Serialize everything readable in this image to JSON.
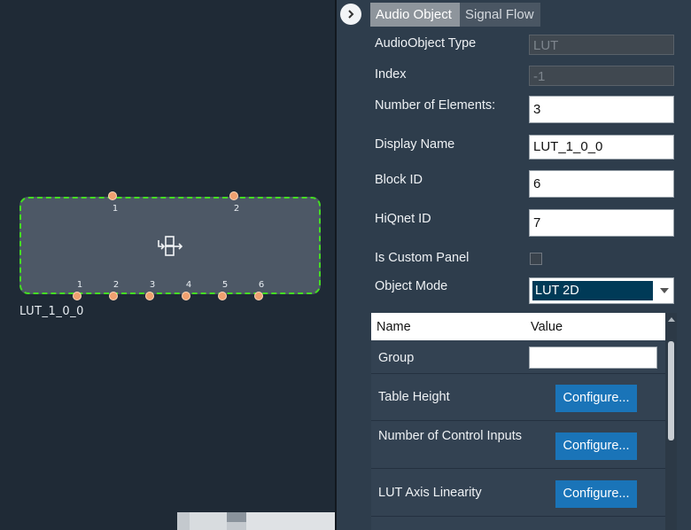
{
  "canvas": {
    "block_name": "LUT_1_0_0",
    "top_pins": [
      "1",
      "2"
    ],
    "bottom_pins": [
      "1",
      "2",
      "3",
      "4",
      "5",
      "6"
    ],
    "block_icon": "lut-block-icon",
    "block_border_color": "#44dd22"
  },
  "panel": {
    "tabs": [
      {
        "label": "Audio Object"
      },
      {
        "label": "Signal Flow"
      }
    ],
    "properties": {
      "type": {
        "label": "AudioObject Type",
        "value": "LUT"
      },
      "index": {
        "label": "Index",
        "value": "-1"
      },
      "num_elements": {
        "label": "Number of Elements:",
        "value": "3"
      },
      "display_name": {
        "label": "Display Name",
        "value": "LUT_1_0_0"
      },
      "block_id": {
        "label": "Block ID",
        "value": "6"
      },
      "hiqnet_id": {
        "label": "HiQnet ID",
        "value": "7"
      },
      "custom_panel": {
        "label": "Is Custom Panel"
      },
      "object_mode": {
        "label": "Object Mode",
        "value": "LUT 2D"
      }
    },
    "grid": {
      "header": {
        "name": "Name",
        "value": "Value"
      },
      "rows": [
        {
          "name": "Group"
        },
        {
          "name": "Table Height",
          "button": "Configure..."
        },
        {
          "name": "Number of Control Inputs",
          "button": "Configure..."
        },
        {
          "name": "LUT Axis Linearity",
          "button": "Configure..."
        }
      ]
    }
  },
  "colors": {
    "accent_button": "#1a74b8",
    "selected_mode": "#003a57",
    "pin": "#f0a070"
  }
}
